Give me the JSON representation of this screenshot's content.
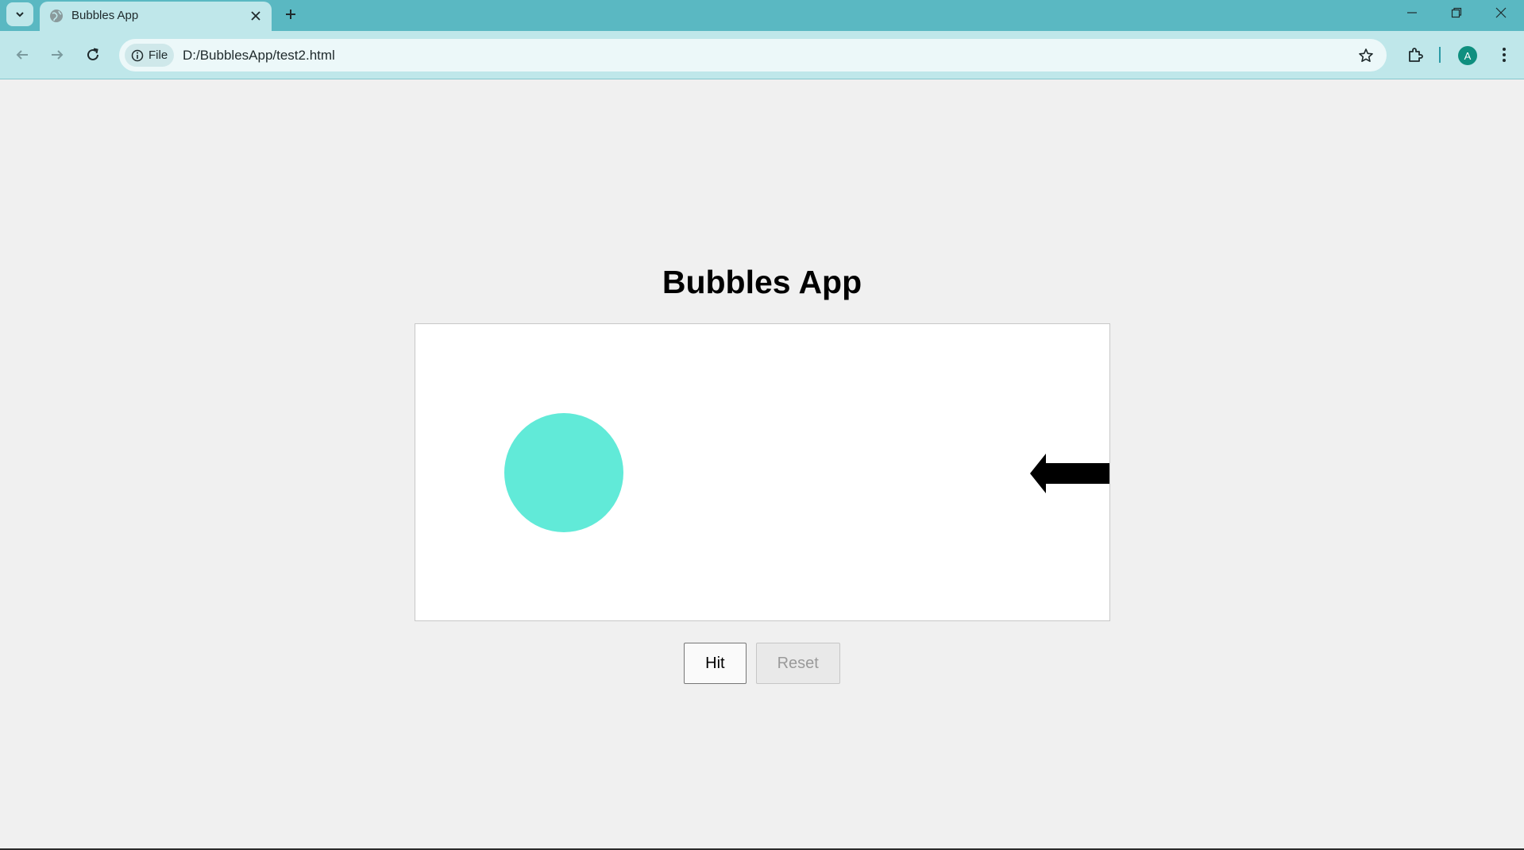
{
  "browser": {
    "tab": {
      "title": "Bubbles App",
      "favicon": "globe-icon"
    },
    "new_tab_icon": "plus-icon",
    "address_bar": {
      "site_chip_label": "File",
      "url": "D:/BubblesApp/test2.html"
    },
    "profile_initial": "A",
    "colors": {
      "tabstrip": "#5ab8c2",
      "toolbar": "#bfe7ea",
      "avatar": "#0f8f7f"
    }
  },
  "page": {
    "title": "Bubbles App",
    "stage": {
      "bubble_color": "#61ead8",
      "arrow_color": "#000000",
      "arrow_direction": "left"
    },
    "buttons": {
      "hit_label": "Hit",
      "reset_label": "Reset",
      "reset_disabled": true
    }
  }
}
